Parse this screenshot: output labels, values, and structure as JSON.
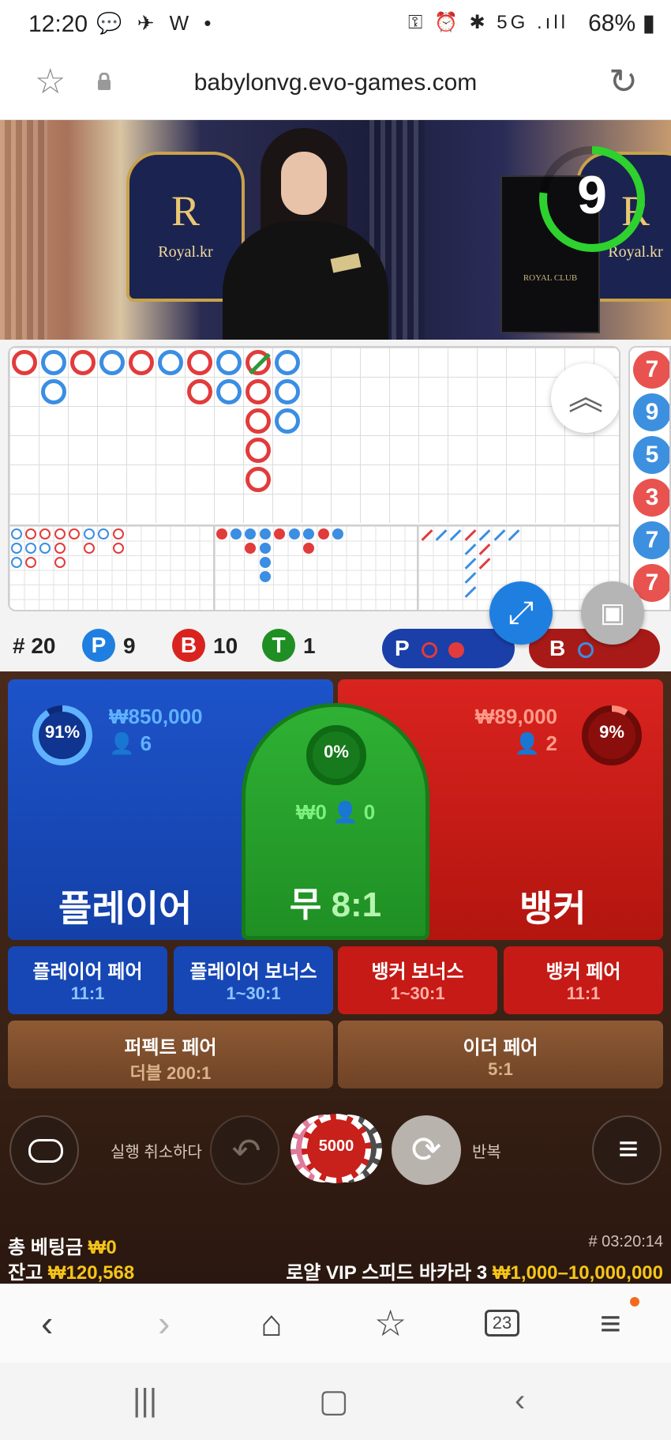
{
  "status_bar": {
    "time": "12:20",
    "left_icons": [
      "chat-bubble-icon",
      "telegram-icon",
      "w-icon",
      "dot-icon"
    ],
    "left_icons_text": "💬 ✈ W •",
    "right_icons": [
      "key-icon",
      "alarm-icon",
      "bluetooth-icon",
      "5g-icon",
      "signal-icon"
    ],
    "right_icons_text": "⚿ ⏰ ✱ 5G .ıll",
    "battery": "68%"
  },
  "address_bar": {
    "url": "babylonvg.evo-games.com"
  },
  "video": {
    "countdown": "9",
    "logo_text": "Royal.kr",
    "crest": "R",
    "sign_text": "ROYAL CLUB"
  },
  "roadmap": {
    "bead_column": [
      {
        "value": "7",
        "side": "banker"
      },
      {
        "value": "9",
        "side": "player"
      },
      {
        "value": "5",
        "side": "player"
      },
      {
        "value": "3",
        "side": "banker"
      },
      {
        "value": "7",
        "side": "player"
      },
      {
        "value": "7",
        "side": "banker"
      }
    ],
    "stats": {
      "round_label": "# 20",
      "player_letter": "P",
      "player_count": "9",
      "banker_letter": "B",
      "banker_count": "10",
      "tie_letter": "T",
      "tie_count": "1"
    },
    "predict_player": "P",
    "predict_banker": "B"
  },
  "bets": {
    "player": {
      "name": "플레이어",
      "pct": "91%",
      "pct_value": 91,
      "amount": "₩850,000",
      "players": "6"
    },
    "tie": {
      "name": "무",
      "odds": "8:1",
      "pct": "0%",
      "pct_value": 0,
      "amount": "₩0",
      "players": "0"
    },
    "banker": {
      "name": "뱅커",
      "pct": "9%",
      "pct_value": 9,
      "amount": "₩89,000",
      "players": "2"
    },
    "side_bets": [
      {
        "name": "플레이어 페어",
        "odds": "11:1",
        "color": "blue"
      },
      {
        "name": "플레이어 보너스",
        "odds": "1~30:1",
        "color": "blue"
      },
      {
        "name": "뱅커 보너스",
        "odds": "1~30:1",
        "color": "red"
      },
      {
        "name": "뱅커 페어",
        "odds": "11:1",
        "color": "red"
      }
    ],
    "special_bets": [
      {
        "name": "퍼펙트 페어",
        "odds": "더블 200:1"
      },
      {
        "name": "이더 페어",
        "odds": "5:1"
      }
    ]
  },
  "controls": {
    "undo_label": "실행 취소하다",
    "chip_value": "5000",
    "repeat_label": "반복"
  },
  "footer": {
    "total_bet_label": "총 베팅금",
    "total_bet_value": "₩0",
    "balance_label": "잔고",
    "balance_value": "₩120,568",
    "game_id": "# 03:20:14",
    "table_name": "로얄 VIP 스피드 바카라 3",
    "limits": "₩1,000–10,000,000"
  },
  "browser_bar": {
    "tabs_count": "23"
  },
  "colors": {
    "player_blue": "#1d53c9",
    "banker_red": "#d9231f",
    "tie_green": "#2fb134",
    "gold": "#f5c518"
  }
}
